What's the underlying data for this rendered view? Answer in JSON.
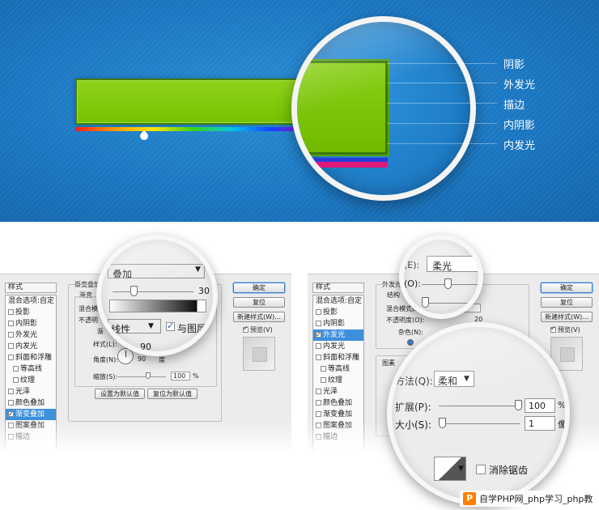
{
  "hero": {
    "callouts": [
      "阴影",
      "外发光",
      "描边",
      "内阴影",
      "内发光"
    ]
  },
  "left_dialog": {
    "styles_title": "样式",
    "style_items": [
      {
        "label": "混合选项:自定",
        "checkbox": false,
        "checked": false,
        "indent": false,
        "selected": false
      },
      {
        "label": "投影",
        "checkbox": true,
        "checked": false,
        "indent": false,
        "selected": false
      },
      {
        "label": "内阴影",
        "checkbox": true,
        "checked": false,
        "indent": false,
        "selected": false
      },
      {
        "label": "外发光",
        "checkbox": true,
        "checked": false,
        "indent": false,
        "selected": false
      },
      {
        "label": "内发光",
        "checkbox": true,
        "checked": false,
        "indent": false,
        "selected": false
      },
      {
        "label": "斜面和浮雕",
        "checkbox": true,
        "checked": false,
        "indent": false,
        "selected": false
      },
      {
        "label": "等高线",
        "checkbox": true,
        "checked": false,
        "indent": true,
        "selected": false
      },
      {
        "label": "纹理",
        "checkbox": true,
        "checked": false,
        "indent": true,
        "selected": false
      },
      {
        "label": "光泽",
        "checkbox": true,
        "checked": false,
        "indent": false,
        "selected": false
      },
      {
        "label": "颜色叠加",
        "checkbox": true,
        "checked": false,
        "indent": false,
        "selected": false
      },
      {
        "label": "渐变叠加",
        "checkbox": true,
        "checked": true,
        "indent": false,
        "selected": true
      },
      {
        "label": "图案叠加",
        "checkbox": true,
        "checked": false,
        "indent": false,
        "selected": false
      },
      {
        "label": "描边",
        "checkbox": true,
        "checked": false,
        "indent": false,
        "selected": false
      }
    ],
    "section_title": "渐变叠加",
    "sub_title": "渐变",
    "blend_label": "混合模",
    "opacity_label": "不透明",
    "gradient_label": "渐",
    "style_label": "样式(L):",
    "angle_label": "角度(N):",
    "angle_value": "90",
    "angle_unit": "度",
    "scale_label": "缩放(S):",
    "scale_value": "100",
    "scale_unit": "%",
    "btn_set_default": "设置为默认值",
    "btn_reset_default": "复位为默认值",
    "btn_ok": "确定",
    "btn_reset": "复位",
    "btn_new_style": "新建样式(W)...",
    "preview_label": "预览(V)",
    "preview_checked": true,
    "magnifier": {
      "blend_value": "叠加",
      "opacity_value": "30",
      "style_value": "线性",
      "align_label": "与图层",
      "align_checked": true,
      "angle_partial": "90"
    }
  },
  "right_dialog": {
    "styles_title": "样式",
    "style_items": [
      {
        "label": "混合选项:自定",
        "checkbox": false,
        "checked": false,
        "indent": false,
        "selected": false
      },
      {
        "label": "投影",
        "checkbox": true,
        "checked": false,
        "indent": false,
        "selected": false
      },
      {
        "label": "内阴影",
        "checkbox": true,
        "checked": false,
        "indent": false,
        "selected": false
      },
      {
        "label": "外发光",
        "checkbox": true,
        "checked": true,
        "indent": false,
        "selected": true
      },
      {
        "label": "内发光",
        "checkbox": true,
        "checked": false,
        "indent": false,
        "selected": false
      },
      {
        "label": "斜面和浮雕",
        "checkbox": true,
        "checked": false,
        "indent": false,
        "selected": false
      },
      {
        "label": "等高线",
        "checkbox": true,
        "checked": false,
        "indent": true,
        "selected": false
      },
      {
        "label": "纹理",
        "checkbox": true,
        "checked": false,
        "indent": true,
        "selected": false
      },
      {
        "label": "光泽",
        "checkbox": true,
        "checked": false,
        "indent": false,
        "selected": false
      },
      {
        "label": "颜色叠加",
        "checkbox": true,
        "checked": false,
        "indent": false,
        "selected": false
      },
      {
        "label": "渐变叠加",
        "checkbox": true,
        "checked": false,
        "indent": false,
        "selected": false
      },
      {
        "label": "图案叠加",
        "checkbox": true,
        "checked": false,
        "indent": false,
        "selected": false
      },
      {
        "label": "描边",
        "checkbox": true,
        "checked": false,
        "indent": false,
        "selected": false
      }
    ],
    "section_title": "外发光",
    "struct_label": "结构",
    "blend_label": "混合模式(B):",
    "opacity_label": "不透明度(O):",
    "opacity_value": "20",
    "noise_label": "杂色(N):",
    "elements_label": "图素",
    "btn_ok": "确定",
    "btn_reset": "复位",
    "btn_new_style": "新建样式(W)...",
    "preview_label": "预览(V)",
    "preview_checked": true,
    "magnifier_top": {
      "blend_label_part": "(E):",
      "blend_value": "柔光",
      "opacity_label_part": "(O):"
    },
    "magnifier_bottom": {
      "method_label": "方法(Q):",
      "method_value": "柔和",
      "spread_label": "扩展(P):",
      "spread_value": "100",
      "spread_unit": "%",
      "size_label": "大小(S):",
      "size_value": "1",
      "size_unit": "像",
      "antialias_label": "消除锯齿"
    }
  },
  "watermark": {
    "logo": "P",
    "text": "自学PHP网_php学习_php教"
  }
}
